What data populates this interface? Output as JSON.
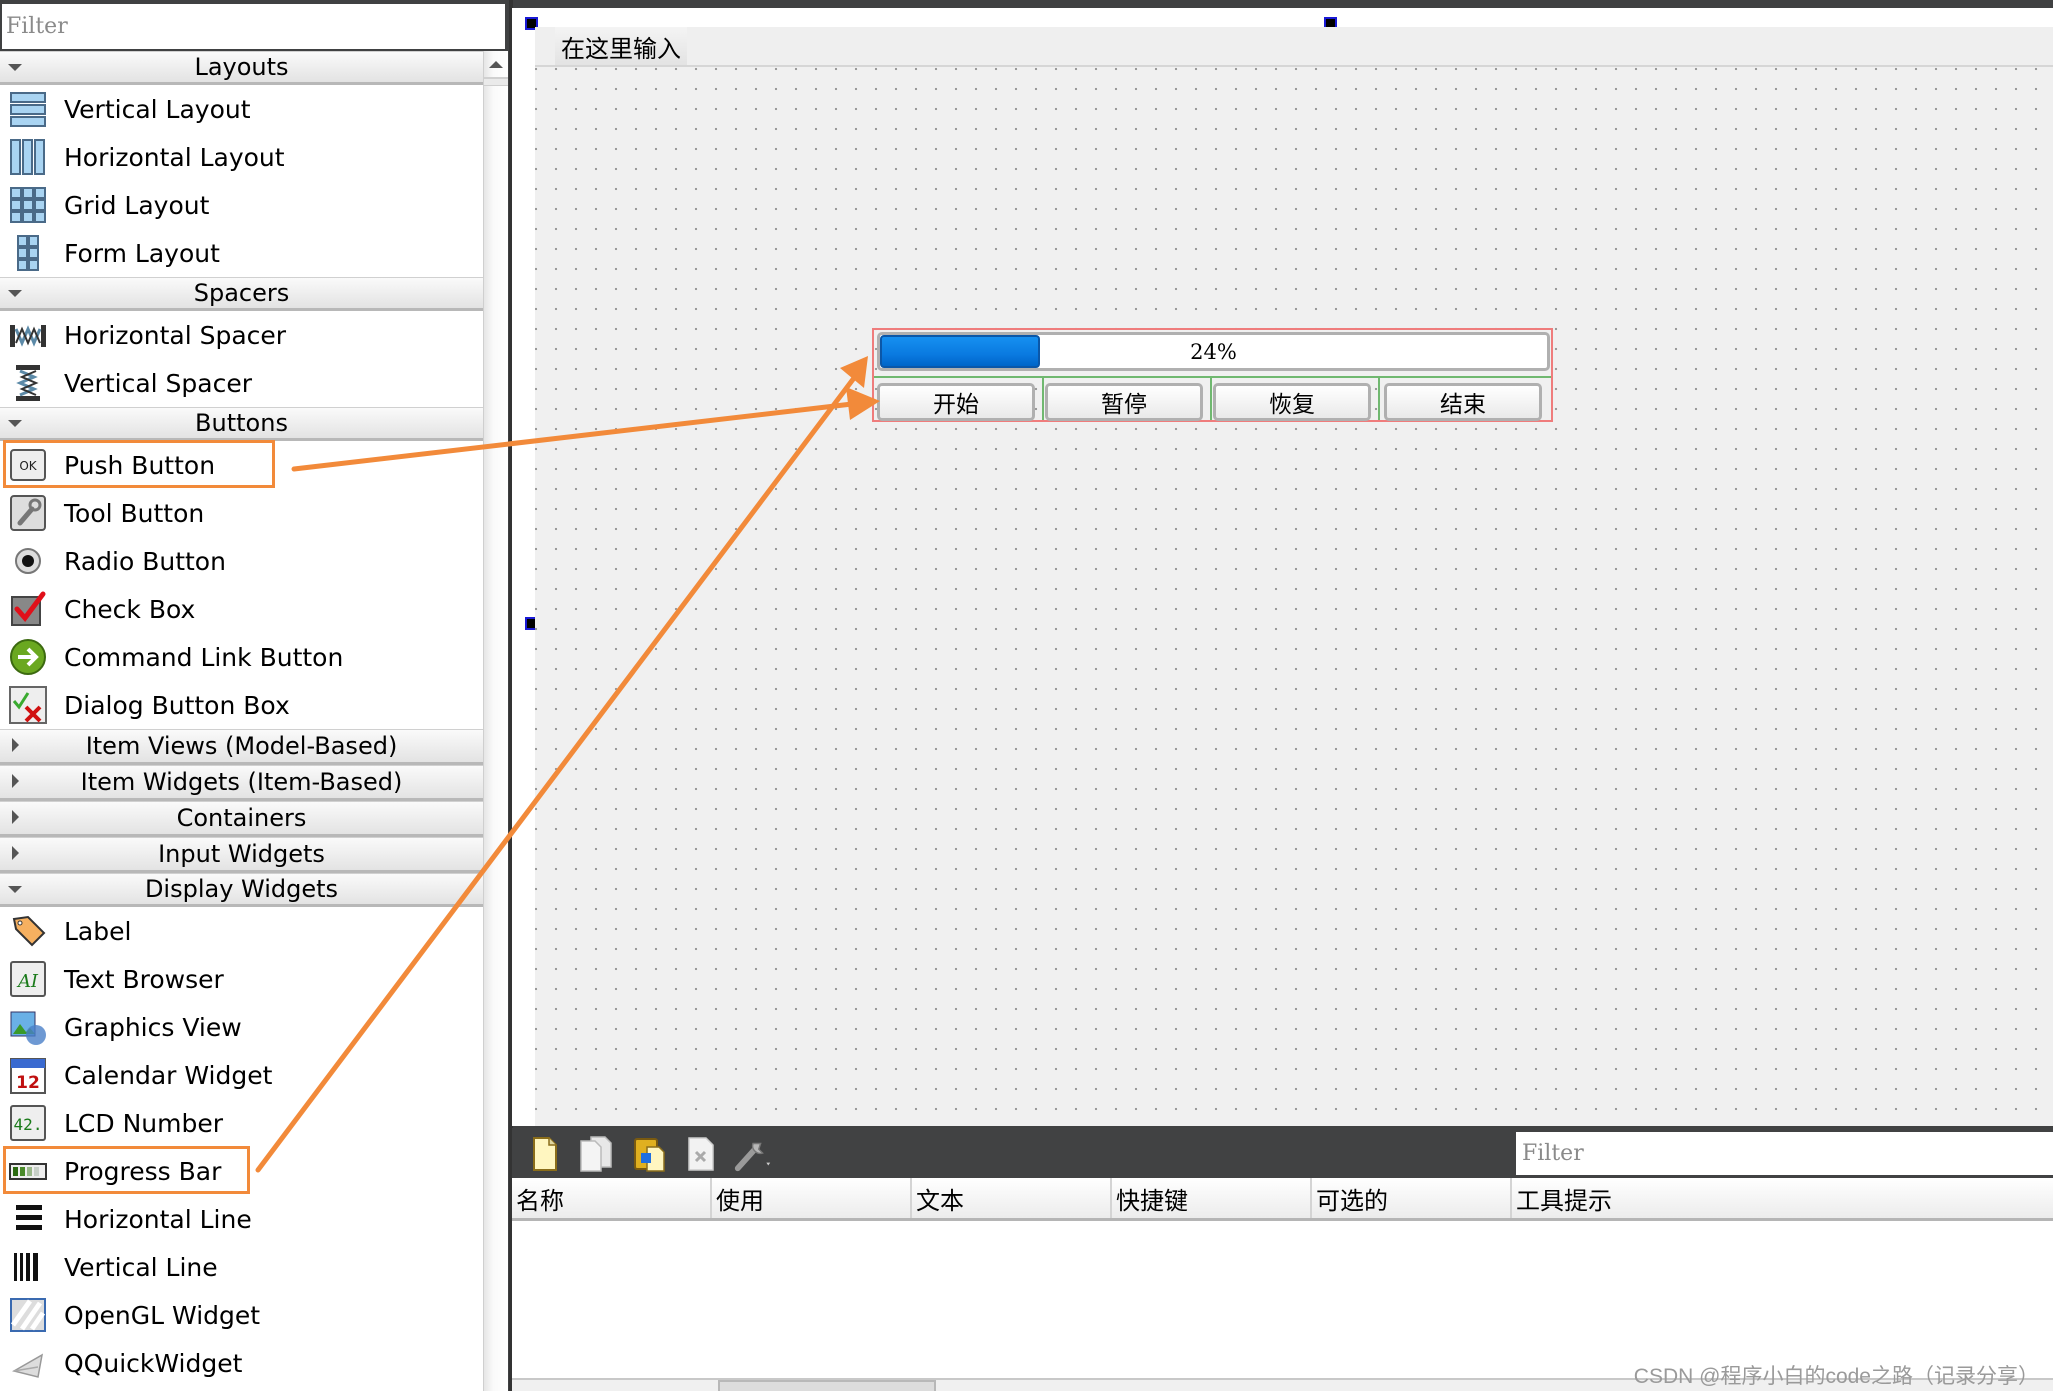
{
  "widget_box": {
    "filter_placeholder": "Filter",
    "categories": [
      {
        "label": "Layouts",
        "expanded": true,
        "items": [
          {
            "label": "Vertical Layout",
            "icon": "vertical-layout-icon"
          },
          {
            "label": "Horizontal Layout",
            "icon": "horizontal-layout-icon"
          },
          {
            "label": "Grid Layout",
            "icon": "grid-layout-icon"
          },
          {
            "label": "Form Layout",
            "icon": "form-layout-icon"
          }
        ]
      },
      {
        "label": "Spacers",
        "expanded": true,
        "items": [
          {
            "label": "Horizontal Spacer",
            "icon": "horizontal-spacer-icon"
          },
          {
            "label": "Vertical Spacer",
            "icon": "vertical-spacer-icon"
          }
        ]
      },
      {
        "label": "Buttons",
        "expanded": true,
        "items": [
          {
            "label": "Push Button",
            "icon": "push-button-icon",
            "highlighted": true
          },
          {
            "label": "Tool Button",
            "icon": "tool-button-icon"
          },
          {
            "label": "Radio Button",
            "icon": "radio-button-icon"
          },
          {
            "label": "Check Box",
            "icon": "check-box-icon"
          },
          {
            "label": "Command Link Button",
            "icon": "command-link-icon"
          },
          {
            "label": "Dialog Button Box",
            "icon": "dialog-button-box-icon"
          }
        ]
      },
      {
        "label": "Item Views (Model-Based)",
        "expanded": false
      },
      {
        "label": "Item Widgets (Item-Based)",
        "expanded": false
      },
      {
        "label": "Containers",
        "expanded": false
      },
      {
        "label": "Input Widgets",
        "expanded": false
      },
      {
        "label": "Display Widgets",
        "expanded": true,
        "items": [
          {
            "label": "Label",
            "icon": "label-icon"
          },
          {
            "label": "Text Browser",
            "icon": "text-browser-icon"
          },
          {
            "label": "Graphics View",
            "icon": "graphics-view-icon"
          },
          {
            "label": "Calendar Widget",
            "icon": "calendar-icon"
          },
          {
            "label": "LCD Number",
            "icon": "lcd-number-icon"
          },
          {
            "label": "Progress Bar",
            "icon": "progress-bar-icon",
            "highlighted": true
          },
          {
            "label": "Horizontal Line",
            "icon": "horizontal-line-icon"
          },
          {
            "label": "Vertical Line",
            "icon": "vertical-line-icon"
          },
          {
            "label": "OpenGL Widget",
            "icon": "opengl-icon"
          },
          {
            "label": "QQuickWidget",
            "icon": "qquick-widget-icon"
          }
        ]
      }
    ],
    "icon_text": {
      "calendar": "12",
      "lcd": "42.",
      "text_browser": "AI",
      "push_button": "OK"
    }
  },
  "form": {
    "menu_placeholder": "在这里输入",
    "progress": {
      "value_percent": 24,
      "text": "24%"
    },
    "buttons": [
      "开始",
      "暂停",
      "恢复",
      "结束"
    ]
  },
  "action_editor": {
    "filter_placeholder": "Filter",
    "toolbar": [
      "new-action-icon",
      "copy-action-icon",
      "paste-action-icon",
      "delete-action-icon",
      "configure-icon"
    ],
    "columns": [
      "名称",
      "使用",
      "文本",
      "快捷键",
      "可选的",
      "工具提示"
    ]
  },
  "watermark": "CSDN @程序小白的code之路（记录分享）",
  "colors": {
    "annotation": "#f28a3a",
    "layout_border": "#ef7c7c",
    "layout_separator": "#70b870",
    "progress_fill": "#0a7ae0",
    "selection_handle": "#1a1ad6"
  }
}
